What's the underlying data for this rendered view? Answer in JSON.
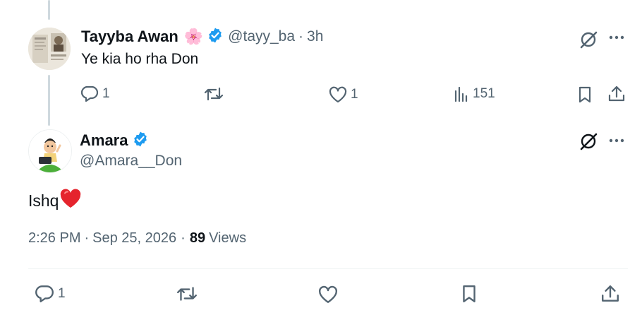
{
  "reply_tweet": {
    "author_name": "Tayyba Awan",
    "name_emoji": "🌸",
    "handle": "@tayy_ba",
    "separator": "·",
    "age": "3h",
    "text": "Ye kia ho rha Don",
    "replies": "1",
    "retweets": "",
    "likes": "1",
    "views": "151"
  },
  "main_tweet": {
    "author_name": "Amara",
    "handle": "@Amara__Don",
    "text": "Ishq",
    "text_emoji": "heart",
    "time": "2:26 PM",
    "sep1": "·",
    "date": "Sep 25, 2026",
    "sep2": "·",
    "views_count": "89",
    "views_label": "Views",
    "replies": "1"
  },
  "colors": {
    "verified": "#1d9bf0",
    "muted": "#536471",
    "divider": "#eff3f4",
    "heart": "#e0245e"
  },
  "icons": [
    "verified-badge-icon",
    "grok-icon",
    "more-icon",
    "reply-icon",
    "retweet-icon",
    "like-icon",
    "views-icon",
    "bookmark-icon",
    "share-icon"
  ]
}
